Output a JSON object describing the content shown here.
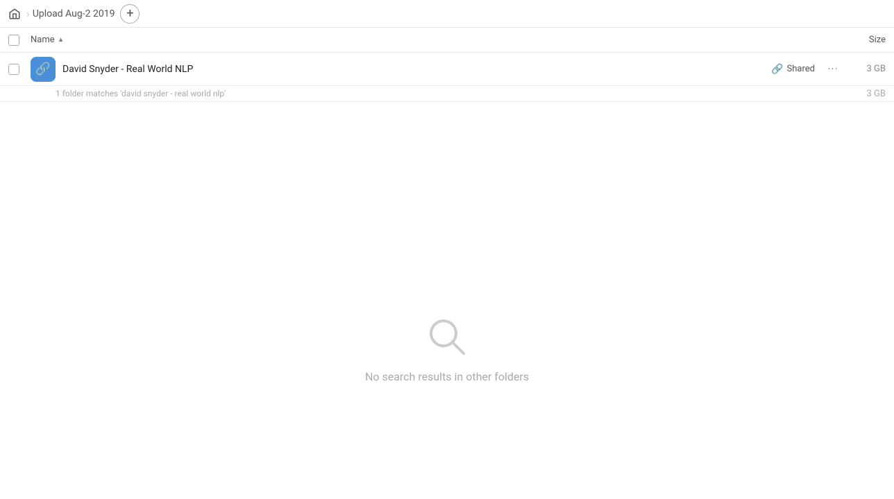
{
  "breadcrumb": {
    "home_label": "Home",
    "current_folder": "Upload Aug-2 2019",
    "separator": "›"
  },
  "add_button_label": "+",
  "column_headers": {
    "name_label": "Name",
    "sort_indicator": "▲",
    "size_label": "Size"
  },
  "file_row": {
    "name": "David Snyder - Real World NLP",
    "shared_label": "Shared",
    "size": "3 GB",
    "match_text": "1 folder matches 'david snyder - real world nlp'",
    "match_size": "3 GB"
  },
  "empty_state": {
    "message": "No search results in other folders"
  },
  "more_btn_label": "···"
}
